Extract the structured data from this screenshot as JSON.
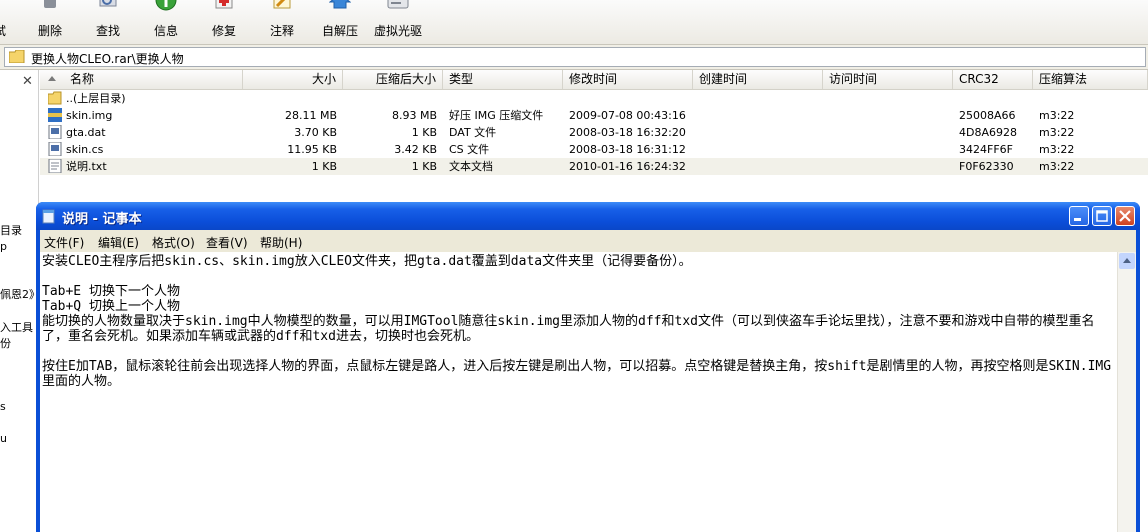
{
  "toolbar": {
    "items": [
      {
        "label": "试",
        "icon": "toolbar-icon"
      },
      {
        "label": "删除",
        "icon": "trash-icon"
      },
      {
        "label": "查找",
        "icon": "search-icon"
      },
      {
        "label": "信息",
        "icon": "info-icon"
      },
      {
        "label": "修复",
        "icon": "repair-icon"
      },
      {
        "label": "注释",
        "icon": "comment-icon"
      },
      {
        "label": "自解压",
        "icon": "sfx-icon"
      },
      {
        "label": "虚拟光驱",
        "icon": "virtual-drive-icon"
      }
    ]
  },
  "address": {
    "path": "更换人物CLEO.rar\\更换人物"
  },
  "left_pane": {
    "fragments": [
      "目录",
      "p",
      "佩恩2》",
      "入工具",
      "份",
      "s",
      "u"
    ]
  },
  "file_list": {
    "columns": [
      "名称",
      "大小",
      "压缩后大小",
      "类型",
      "修改时间",
      "创建时间",
      "访问时间",
      "CRC32",
      "压缩算法"
    ],
    "rows": [
      {
        "name": "..(上层目录)",
        "size": "",
        "packed": "",
        "type": "",
        "modified": "",
        "crc": "",
        "method": "",
        "icon": "folder-up-icon"
      },
      {
        "name": "skin.img",
        "size": "28.11 MB",
        "packed": "8.93 MB",
        "type": "好压 IMG 压缩文件",
        "modified": "2009-07-08 00:43:16",
        "crc": "25008A66",
        "method": "m3:22",
        "icon": "archive-file-icon"
      },
      {
        "name": "gta.dat",
        "size": "3.70 KB",
        "packed": "1 KB",
        "type": "DAT 文件",
        "modified": "2008-03-18 16:32:20",
        "crc": "4D8A6928",
        "method": "m3:22",
        "icon": "dat-file-icon"
      },
      {
        "name": "skin.cs",
        "size": "11.95 KB",
        "packed": "3.42 KB",
        "type": "CS 文件",
        "modified": "2008-03-18 16:31:12",
        "crc": "3424FF6F",
        "method": "m3:22",
        "icon": "cs-file-icon"
      },
      {
        "name": "说明.txt",
        "size": "1 KB",
        "packed": "1 KB",
        "type": "文本文档",
        "modified": "2010-01-16 16:24:32",
        "crc": "F0F62330",
        "method": "m3:22",
        "icon": "text-file-icon"
      }
    ]
  },
  "notepad": {
    "title": "说明 - 记事本",
    "menu": [
      "文件(F)",
      "编辑(E)",
      "格式(O)",
      "查看(V)",
      "帮助(H)"
    ],
    "content": "安装CLEO主程序后把skin.cs、skin.img放入CLEO文件夹，把gta.dat覆盖到data文件夹里（记得要备份）。\n\nTab+E 切换下一个人物\nTab+Q 切换上一个人物\n能切换的人物数量取决于skin.img中人物模型的数量，可以用IMGTool随意往skin.img里添加人物的dff和txd文件（可以到侠盗车手论坛里找），注意不要和游戏中自带的模型重名了，重名会死机。如果添加车辆或武器的dff和txd进去，切换时也会死机。\n\n按住E加TAB，鼠标滚轮往前会出现选择人物的界面，点鼠标左键是路人，进入后按左键是刷出人物，可以招募。点空格键是替换主角，按shift是剧情里的人物，再按空格则是SKIN.IMG里面的人物。"
  },
  "colors": {
    "titlebar": "#0b4ed9",
    "selected_row": "#f2f1e9",
    "menu_bg": "#ece9d8"
  }
}
